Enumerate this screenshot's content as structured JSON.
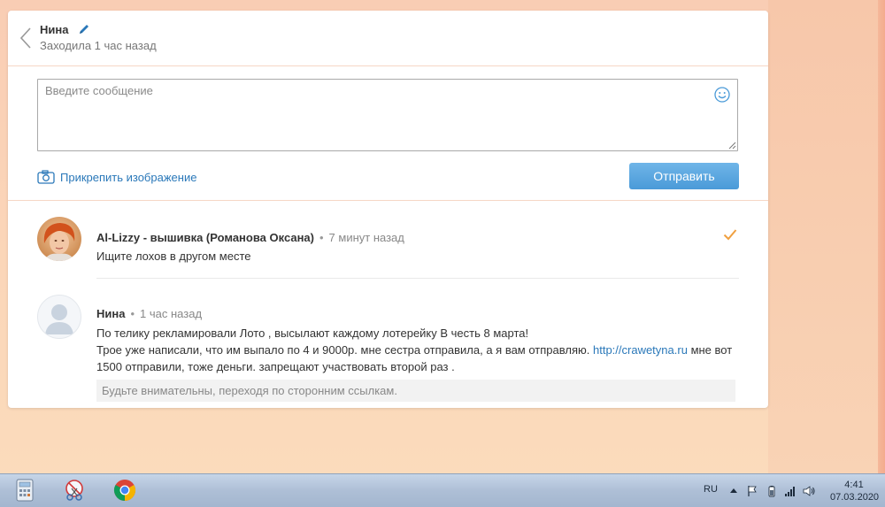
{
  "header": {
    "name": "Нина",
    "status": "Заходила 1 час назад"
  },
  "composer": {
    "placeholder": "Введите сообщение",
    "attach_label": "Прикрепить изображение",
    "send_label": "Отправить"
  },
  "messages": [
    {
      "author": "Al-Lizzy - вышивка (Романова Оксана)",
      "time": "7 минут назад",
      "lines": [
        "Ищите лохов в другом месте"
      ],
      "read": true
    },
    {
      "author": "Нина",
      "time": "1 час назад",
      "line1": "По телику рекламировали Лото , высылают каждому лотерейку В честь 8 марта!",
      "line2_before": "Трое уже написали, что им выпало по 4 и 9000р. мне сестра отправила, а я вам отправляю.",
      "link": "http://crawetyna.ru",
      "line2_after": "мне вот",
      "line3": "1500 отправили, тоже деньги. запрещают участвовать второй раз .",
      "warning": "Будьте внимательны, переходя по сторонним ссылкам."
    }
  ],
  "taskbar": {
    "lang": "RU",
    "time": "4:41",
    "date": "07.03.2020"
  },
  "colors": {
    "accent": "#2a78b9",
    "send_button": "#4a9ad8",
    "check": "#f0a040"
  }
}
